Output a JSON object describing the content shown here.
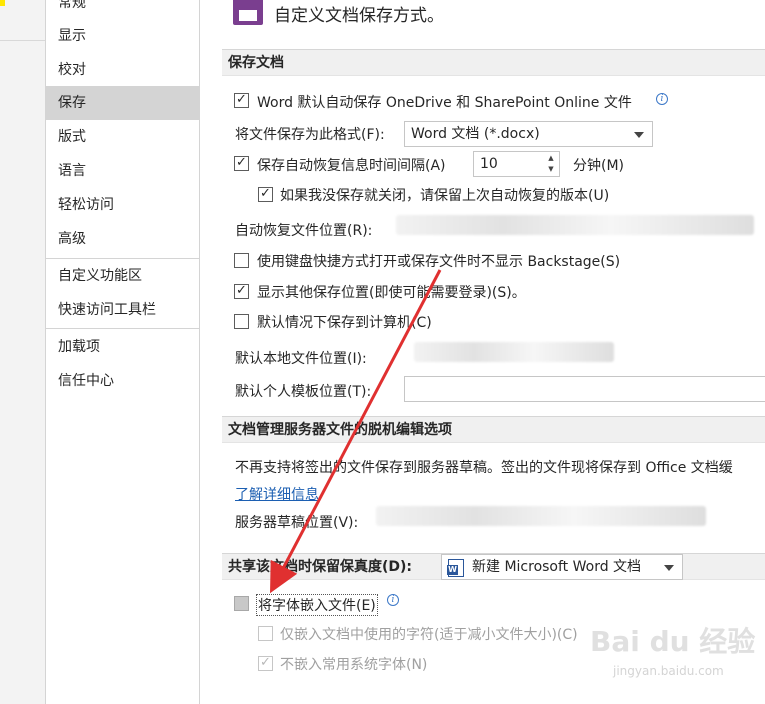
{
  "nav": {
    "items": [
      {
        "label": "常规"
      },
      {
        "label": "显示"
      },
      {
        "label": "校对"
      },
      {
        "label": "保存"
      },
      {
        "label": "版式"
      },
      {
        "label": "语言"
      },
      {
        "label": "轻松访问"
      },
      {
        "label": "高级"
      },
      {
        "label": "自定义功能区"
      },
      {
        "label": "快速访问工具栏"
      },
      {
        "label": "加载项"
      },
      {
        "label": "信任中心"
      }
    ],
    "active": "保存"
  },
  "header": {
    "icon": "floppy-disk-icon",
    "title": "自定义文档保存方式。",
    "accent_color": "#7a3e8f"
  },
  "save_section": {
    "title": "保存文档",
    "onedrive_autosave": {
      "label": "Word 默认自动保存 OneDrive 和 SharePoint Online 文件",
      "checked": true
    },
    "format": {
      "label": "将文件保存为此格式(F):",
      "value": "Word 文档 (*.docx)"
    },
    "autorecover_interval": {
      "label": "保存自动恢复信息时间间隔(A)",
      "checked": true,
      "value": "10",
      "unit": "分钟(M)"
    },
    "keep_last_version": {
      "label": "如果我没保存就关闭，请保留上次自动恢复的版本(U)",
      "checked": true
    },
    "autorecover_location": {
      "label": "自动恢复文件位置(R):"
    },
    "no_backstage": {
      "label": "使用键盘快捷方式打开或保存文件时不显示 Backstage(S)",
      "checked": false
    },
    "show_more_locations": {
      "label": "显示其他保存位置(即使可能需要登录)(S)。",
      "checked": true
    },
    "save_to_computer": {
      "label": "默认情况下保存到计算机(C)",
      "checked": false
    },
    "local_location": {
      "label": "默认本地文件位置(I):"
    },
    "template_location": {
      "label": "默认个人模板位置(T):"
    }
  },
  "offline_section": {
    "title": "文档管理服务器文件的脱机编辑选项",
    "description": "不再支持将签出的文件保存到服务器草稿。签出的文件现将保存到 Office 文档缓",
    "learn_more": "了解详细信息",
    "drafts_location": {
      "label": "服务器草稿位置(V):"
    }
  },
  "fidelity_section": {
    "title": "共享该文档时保留保真度(D):",
    "document": "新建 Microsoft Word 文档",
    "embed_fonts": {
      "label": "将字体嵌入文件(E)",
      "checked": false
    },
    "embed_used_chars": {
      "label": "仅嵌入文档中使用的字符(适于减小文件大小)(C)",
      "checked": false,
      "disabled": true
    },
    "no_common_fonts": {
      "label": "不嵌入常用系统字体(N)",
      "checked": true,
      "disabled": true
    }
  },
  "annotation": {
    "color": "#e03030"
  },
  "watermark": {
    "text": "Bai du 经验",
    "sub": "jingyan.baidu.com"
  }
}
